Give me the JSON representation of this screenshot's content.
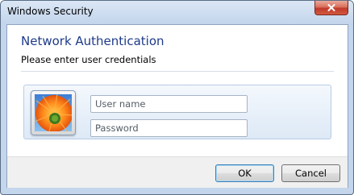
{
  "window": {
    "title": "Windows Security",
    "close_icon": "close-icon"
  },
  "dialog": {
    "heading": "Network Authentication",
    "subheading": "Please enter user credentials"
  },
  "credentials": {
    "avatar_icon": "user-tile-flower-icon",
    "username": {
      "placeholder": "User name",
      "value": ""
    },
    "password": {
      "placeholder": "Password",
      "value": ""
    }
  },
  "buttons": {
    "ok_label": "OK",
    "cancel_label": "Cancel"
  },
  "colors": {
    "heading": "#1e3a8a",
    "titlebar": "#c4d6ec",
    "close_button": "#c0392b",
    "footer": "#f0f0f0"
  }
}
